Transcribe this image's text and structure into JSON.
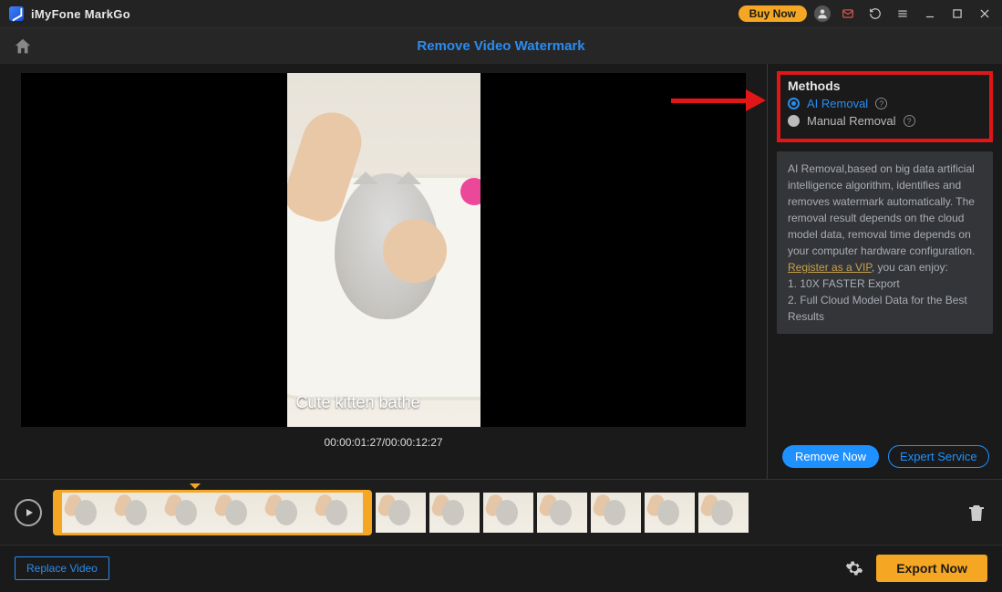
{
  "titlebar": {
    "app_name": "iMyFone MarkGo",
    "buy_now": "Buy Now"
  },
  "subhead": {
    "title": "Remove Video Watermark"
  },
  "preview": {
    "watermark_text": "Cute kitten bathe",
    "timecode": "00:00:01:27/00:00:12:27"
  },
  "methods": {
    "heading": "Methods",
    "option_ai": "AI Removal",
    "option_manual": "Manual Removal"
  },
  "description": {
    "body1": "AI Removal,based on big data artificial intelligence algorithm, identifies and removes watermark automatically. The removal result depends on the cloud model data, removal time depends on your computer hardware configuration.",
    "vip_link": "Register as a VIP",
    "body2": ", you can enjoy:",
    "bullet1": "1. 10X FASTER Export",
    "bullet2": "2. Full Cloud Model Data for the Best Results"
  },
  "actions": {
    "remove_now": "Remove Now",
    "expert_service": "Expert Service"
  },
  "footer": {
    "replace_video": "Replace Video",
    "export_now": "Export Now"
  }
}
